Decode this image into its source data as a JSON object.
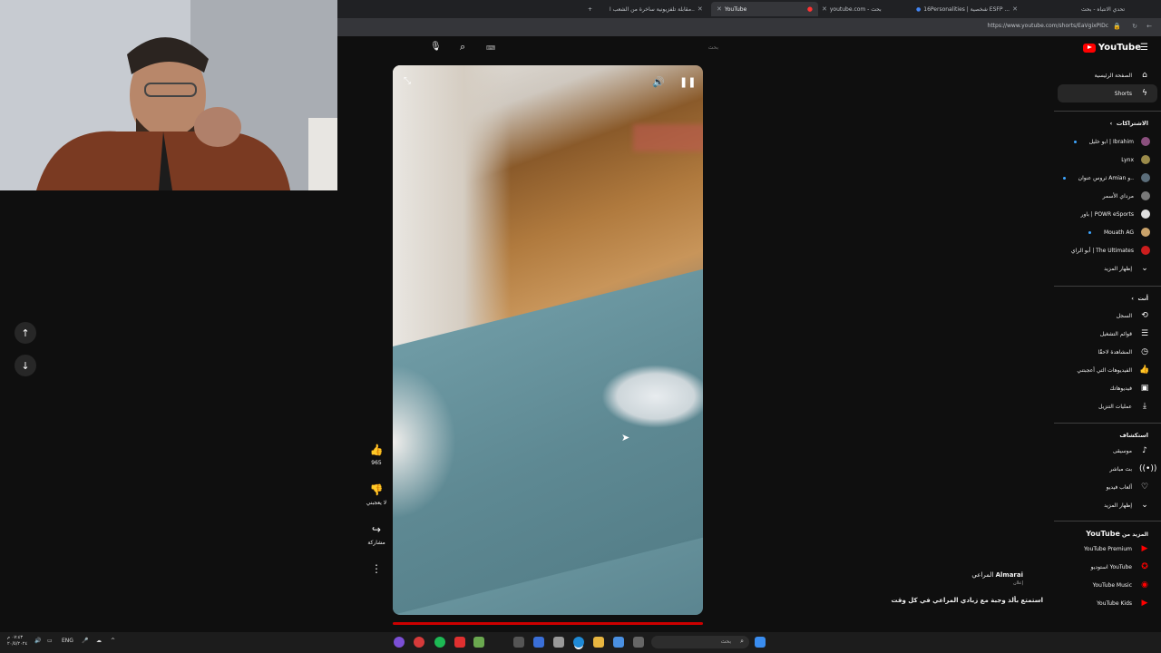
{
  "browser": {
    "tabs": [
      {
        "label": "مقابلة تلفزيونية ساخرة من الشعب ا..",
        "active": false
      },
      {
        "label": "YouTube",
        "active": true
      },
      {
        "label": "youtube.com - بحث",
        "active": false
      },
      {
        "label": "16Personalities | شخصية ESFP ...",
        "active": false
      },
      {
        "label": "تحدي الانتباه - بحث",
        "active": false
      }
    ],
    "new_tab_label": "+",
    "url": "https://www.youtube.com/shorts/EaVgixPIDc"
  },
  "header": {
    "logo_text": "YouTube",
    "search_placeholder": "بحث"
  },
  "actions": {
    "like_count": "965",
    "dislike_label": "لا يعجبني",
    "share_label": "مشاركة"
  },
  "channel": {
    "name": "Almarai",
    "name_ar": "المراعي",
    "sub": "إعلان",
    "caption": "استمتع بألذ وجبة مع زبادي المراعي في كل وقت"
  },
  "sidebar": {
    "top": [
      {
        "label": "الصفحة الرئيسية",
        "icon": "home-icon"
      },
      {
        "label": "Shorts",
        "icon": "shorts-icon"
      }
    ],
    "subs_header": "الاشتراكات",
    "subs": [
      {
        "label": "ابو خليل | Ibrahim",
        "color": "#8a4f7d",
        "dot": true
      },
      {
        "label": "Lynx",
        "color": "#9b8b4a",
        "dot": false
      },
      {
        "label": "ثروس عنوان Amian و..",
        "color": "#5b6d7a",
        "dot": true
      },
      {
        "label": "مرداي الأسمر",
        "color": "#7a7a7a",
        "dot": false
      },
      {
        "label": "باور | POWR eSports",
        "color": "#e0e0e0",
        "dot": false
      },
      {
        "label": "Mouath AG",
        "color": "#c9a26a",
        "dot": true
      },
      {
        "label": "أبو الراي | The Ultimates",
        "color": "#cc1d1d",
        "dot": false
      },
      {
        "label": "إظهار المزيد",
        "color": "",
        "dot": false
      }
    ],
    "you_header": "أنت",
    "you": [
      {
        "label": "السجل",
        "icon": "history-icon"
      },
      {
        "label": "قوائم التشغيل",
        "icon": "playlist-icon"
      },
      {
        "label": "المشاهدة لاحقًا",
        "icon": "clock-icon"
      },
      {
        "label": "الفيديوهات التي أعجبتني",
        "icon": "like-icon"
      },
      {
        "label": "فيديوهاتك",
        "icon": "video-icon"
      },
      {
        "label": "عمليات التنزيل",
        "icon": "download-icon"
      }
    ],
    "explore_header": "استكشاف",
    "explore": [
      {
        "label": "موسيقى",
        "icon": "music-icon"
      },
      {
        "label": "بث مباشر",
        "icon": "live-icon"
      },
      {
        "label": "ألعاب فيديو",
        "icon": "gaming-icon"
      },
      {
        "label": "إظهار المزيد",
        "icon": "chevron-down-icon"
      }
    ],
    "more_header_ar": "المزيد من",
    "more_header_yt": "YouTube",
    "more": [
      {
        "label": "YouTube Premium"
      },
      {
        "label": "استوديو YouTube"
      },
      {
        "label": "YouTube Music"
      },
      {
        "label": "YouTube Kids"
      }
    ]
  },
  "taskbar": {
    "search_placeholder": "بحث",
    "lang": "ENG",
    "time": "٠٧:٤٣ م",
    "date": "٢٠/٥/٢٠٢٤"
  }
}
